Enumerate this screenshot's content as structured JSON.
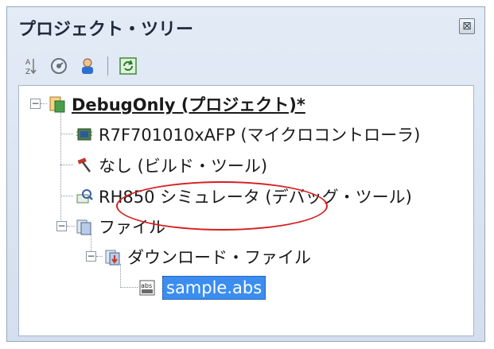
{
  "panel": {
    "title": "プロジェクト・ツリー",
    "close_symbol": "⊠"
  },
  "toolbar": {
    "buttons": [
      {
        "name": "sort-icon"
      },
      {
        "name": "build-mode-icon"
      },
      {
        "name": "user-icon"
      },
      {
        "name": "refresh-icon"
      }
    ]
  },
  "tree": {
    "root": "DebugOnly (プロジェクト)*",
    "microcontroller": "R7F701010xAFP (マイクロコントローラ)",
    "build_tool": "なし (ビルド・ツール)",
    "debug_tool": "RH850 シミュレータ (デバッグ・ツール)",
    "files": "ファイル",
    "download_files": "ダウンロード・ファイル",
    "file_item": "sample.abs",
    "file_badge": "abs"
  },
  "colors": {
    "selection": "#3b8df0",
    "highlight_ring": "#d61f1f",
    "panel_bg": "#d9e4f2"
  }
}
